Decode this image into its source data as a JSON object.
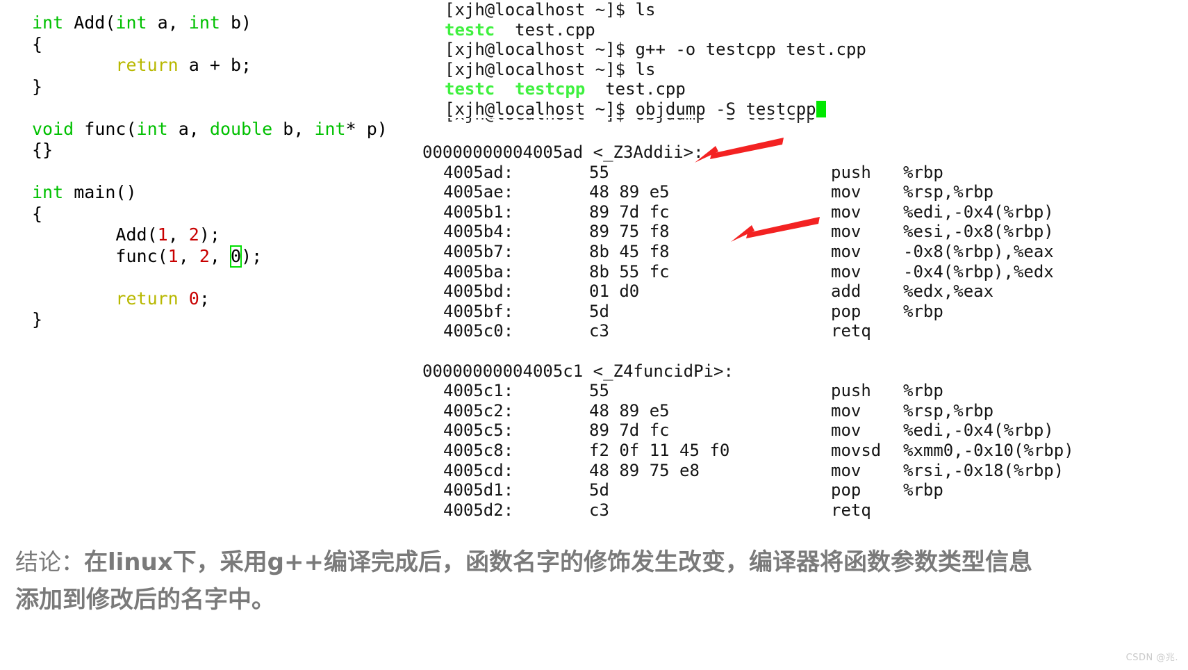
{
  "code": {
    "lines": [
      [
        {
          "t": "int",
          "c": "kw"
        },
        {
          "t": " Add(",
          "c": "plain"
        },
        {
          "t": "int",
          "c": "kw"
        },
        {
          "t": " a, ",
          "c": "plain"
        },
        {
          "t": "int",
          "c": "kw"
        },
        {
          "t": " b)",
          "c": "plain"
        }
      ],
      [
        {
          "t": "{",
          "c": "plain"
        }
      ],
      [
        {
          "t": "        ",
          "c": "plain"
        },
        {
          "t": "return",
          "c": "ret-kw"
        },
        {
          "t": " a + b;",
          "c": "plain"
        }
      ],
      [
        {
          "t": "}",
          "c": "plain"
        }
      ],
      [
        {
          "t": " ",
          "c": "plain"
        }
      ],
      [
        {
          "t": "void",
          "c": "kw"
        },
        {
          "t": " func(",
          "c": "plain"
        },
        {
          "t": "int",
          "c": "kw"
        },
        {
          "t": " a, ",
          "c": "plain"
        },
        {
          "t": "double",
          "c": "kw"
        },
        {
          "t": " b, ",
          "c": "plain"
        },
        {
          "t": "int",
          "c": "kw"
        },
        {
          "t": "* p)",
          "c": "plain"
        }
      ],
      [
        {
          "t": "{}",
          "c": "plain"
        }
      ],
      [
        {
          "t": " ",
          "c": "plain"
        }
      ],
      [
        {
          "t": "int",
          "c": "kw"
        },
        {
          "t": " main()",
          "c": "plain"
        }
      ],
      [
        {
          "t": "{",
          "c": "plain"
        }
      ],
      [
        {
          "t": "        Add(",
          "c": "plain"
        },
        {
          "t": "1",
          "c": "num"
        },
        {
          "t": ", ",
          "c": "plain"
        },
        {
          "t": "2",
          "c": "num"
        },
        {
          "t": ");",
          "c": "plain"
        }
      ],
      [
        {
          "t": "        func(",
          "c": "plain"
        },
        {
          "t": "1",
          "c": "num"
        },
        {
          "t": ", ",
          "c": "plain"
        },
        {
          "t": "2",
          "c": "num"
        },
        {
          "t": ", ",
          "c": "plain"
        },
        {
          "t": "0",
          "c": "cursor-box"
        },
        {
          "t": ");",
          "c": "plain"
        }
      ],
      [
        {
          "t": " ",
          "c": "plain"
        }
      ],
      [
        {
          "t": "        ",
          "c": "plain"
        },
        {
          "t": "return",
          "c": "ret-kw"
        },
        {
          "t": " ",
          "c": "plain"
        },
        {
          "t": "0",
          "c": "num"
        },
        {
          "t": ";",
          "c": "plain"
        }
      ],
      [
        {
          "t": "}",
          "c": "plain"
        }
      ]
    ]
  },
  "terminal": {
    "prompt": "[xjh@localhost ~]$",
    "lines": [
      {
        "type": "command",
        "prompt": "[xjh@localhost ~]$",
        "command": " ls"
      },
      {
        "type": "ls_output",
        "entries": [
          {
            "name": "testc",
            "kind": "executable"
          },
          {
            "name": "test.cpp",
            "kind": "file"
          }
        ]
      },
      {
        "type": "command",
        "prompt": "[xjh@localhost ~]$",
        "command": " g++ -o testcpp test.cpp"
      },
      {
        "type": "command",
        "prompt": "[xjh@localhost ~]$",
        "command": " ls"
      },
      {
        "type": "ls_output",
        "entries": [
          {
            "name": "testc",
            "kind": "executable"
          },
          {
            "name": "testcpp",
            "kind": "executable"
          },
          {
            "name": "test.cpp",
            "kind": "file"
          }
        ]
      },
      {
        "type": "command_cursor",
        "prompt": "[xjh@localhost ~]$",
        "command": " objdump -S testcpp"
      }
    ]
  },
  "disassembly": {
    "sections": [
      {
        "header": "00000000004005ad <_Z3Addii>:",
        "mangled_name": "_Z3Addii",
        "annotated": true,
        "rows": [
          {
            "addr": "4005ad:",
            "bytes": "55",
            "mnem": "push",
            "ops": "%rbp"
          },
          {
            "addr": "4005ae:",
            "bytes": "48 89 e5",
            "mnem": "mov",
            "ops": "%rsp,%rbp"
          },
          {
            "addr": "4005b1:",
            "bytes": "89 7d fc",
            "mnem": "mov",
            "ops": "%edi,-0x4(%rbp)"
          },
          {
            "addr": "4005b4:",
            "bytes": "89 75 f8",
            "mnem": "mov",
            "ops": "%esi,-0x8(%rbp)"
          },
          {
            "addr": "4005b7:",
            "bytes": "8b 45 f8",
            "mnem": "mov",
            "ops": "-0x8(%rbp),%eax"
          },
          {
            "addr": "4005ba:",
            "bytes": "8b 55 fc",
            "mnem": "mov",
            "ops": "-0x4(%rbp),%edx"
          },
          {
            "addr": "4005bd:",
            "bytes": "01 d0",
            "mnem": "add",
            "ops": "%edx,%eax"
          },
          {
            "addr": "4005bf:",
            "bytes": "5d",
            "mnem": "pop",
            "ops": "%rbp"
          },
          {
            "addr": "4005c0:",
            "bytes": "c3",
            "mnem": "retq",
            "ops": ""
          }
        ]
      },
      {
        "header": "00000000004005c1 <_Z4funcidPi>:",
        "mangled_name": "_Z4funcidPi",
        "annotated": true,
        "rows": [
          {
            "addr": "4005c1:",
            "bytes": "55",
            "mnem": "push",
            "ops": "%rbp"
          },
          {
            "addr": "4005c2:",
            "bytes": "48 89 e5",
            "mnem": "mov",
            "ops": "%rsp,%rbp"
          },
          {
            "addr": "4005c5:",
            "bytes": "89 7d fc",
            "mnem": "mov",
            "ops": "%edi,-0x4(%rbp)"
          },
          {
            "addr": "4005c8:",
            "bytes": "f2 0f 11 45 f0",
            "mnem": "movsd",
            "ops": "%xmm0,-0x10(%rbp)"
          },
          {
            "addr": "4005cd:",
            "bytes": "48 89 75 e8",
            "mnem": "mov",
            "ops": "%rsi,-0x18(%rbp)"
          },
          {
            "addr": "4005d1:",
            "bytes": "5d",
            "mnem": "pop",
            "ops": "%rbp"
          },
          {
            "addr": "4005d2:",
            "bytes": "c3",
            "mnem": "retq",
            "ops": ""
          }
        ]
      }
    ]
  },
  "conclusion": {
    "label": "结论：",
    "line1": "在linux下，采用g++编译完成后，函数名字的修饰发生改变，编译器将函数参数类型信息",
    "line2": "添加到修改后的名字中。"
  },
  "watermark": "CSDN @兆.",
  "colors": {
    "keyword_green": "#00c000",
    "return_yellow": "#b8b800",
    "number_red": "#c80000",
    "terminal_exec_green": "#3ff03f",
    "cursor_green": "#00e800",
    "arrow_red": "#f32222",
    "conclusion_gray": "#7a7a7a"
  }
}
